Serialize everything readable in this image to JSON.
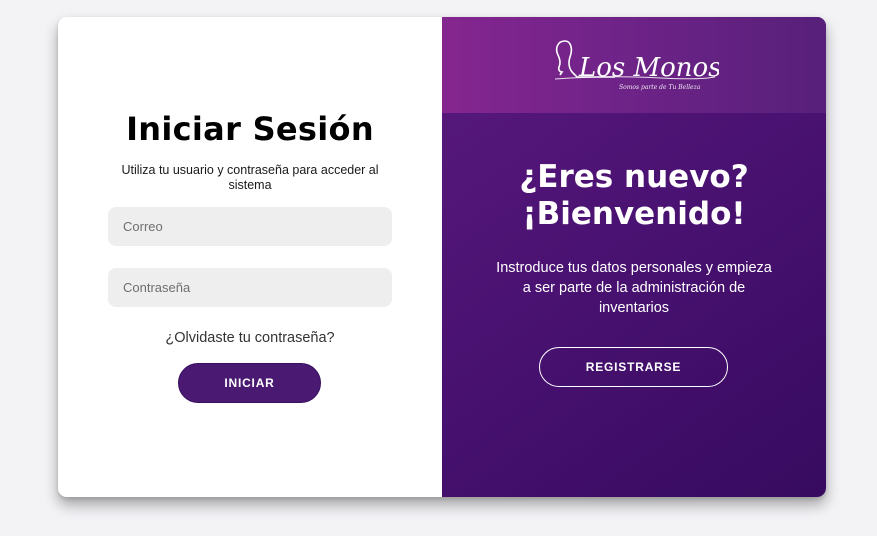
{
  "login": {
    "title": "Iniciar Sesión",
    "subtitle": "Utiliza tu usuario y contraseña para acceder al sistema",
    "email_placeholder": "Correo",
    "password_placeholder": "Contraseña",
    "forgot_label": "¿Olvidaste tu contraseña?",
    "submit_label": "INICIAR"
  },
  "brand": {
    "name": "Los Monos",
    "tagline": "Somos parte de Tu Belleza",
    "band_color": "#7a2590"
  },
  "signup": {
    "heading_line1": "¿Eres nuevo?",
    "heading_line2": "¡Bienvenido!",
    "description": "Instroduce tus datos personales y empieza a ser parte de la administración de inventarios",
    "register_label": "REGISTRARSE"
  },
  "colors": {
    "primary": "#4a1a72",
    "panel": "#4a1272",
    "field_bg": "#eeeeee"
  }
}
